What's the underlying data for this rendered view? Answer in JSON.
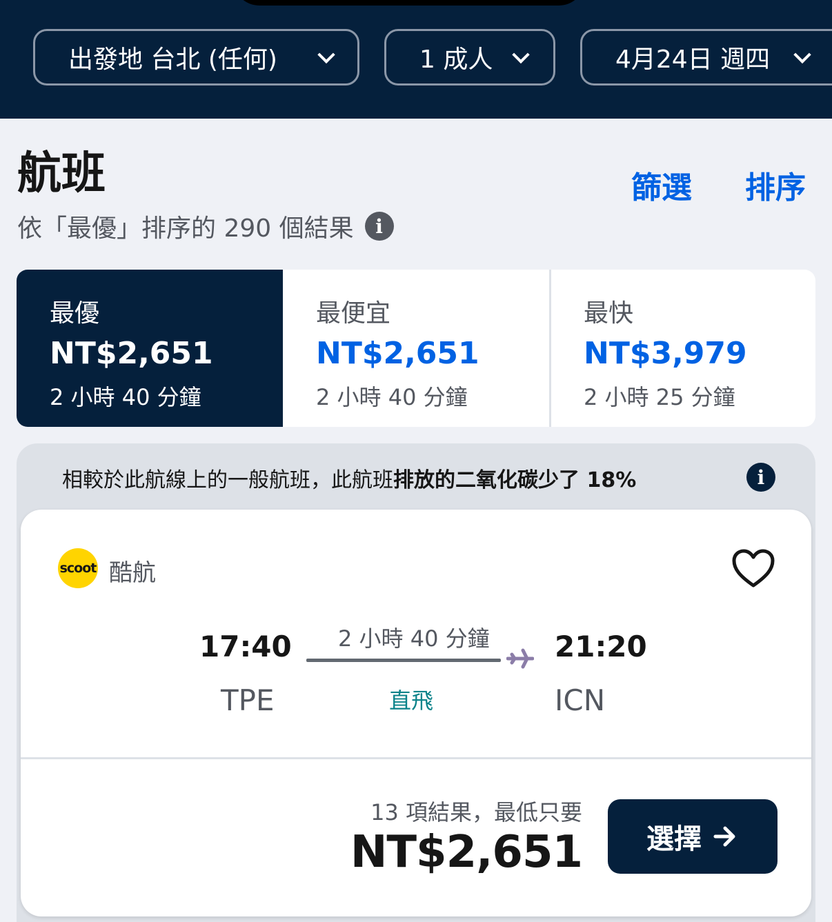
{
  "search": {
    "origin": "出發地 台北 (任何)",
    "passengers": "1 成人",
    "date": "4月24日 週四"
  },
  "results_header": {
    "title": "航班",
    "filter_label": "篩選",
    "sort_label": "排序",
    "subtitle": "依「最優」排序的 290 個結果"
  },
  "sort_tabs": [
    {
      "label": "最優",
      "price": "NT$2,651",
      "duration": "2 小時 40 分鐘",
      "selected": true
    },
    {
      "label": "最便宜",
      "price": "NT$2,651",
      "duration": "2 小時 40 分鐘",
      "selected": false
    },
    {
      "label": "最快",
      "price": "NT$3,979",
      "duration": "2 小時 25 分鐘",
      "selected": false
    }
  ],
  "eco_banner": {
    "text_prefix": "相較於此航線上的一般航班，此航班",
    "text_bold": "排放的二氧化碳少了 18%"
  },
  "flight_card": {
    "airline_logo_text": "scoot",
    "airline_name": "酷航",
    "departure_time": "17:40",
    "departure_code": "TPE",
    "arrival_time": "21:20",
    "arrival_code": "ICN",
    "duration": "2 小時 40 分鐘",
    "stops": "直飛",
    "results_note": "13 項結果，最低只要",
    "price": "NT$2,651",
    "select_label": "選擇"
  },
  "icons": {
    "dropdown": "chevron-down-icon",
    "info": "info-icon",
    "favorite": "heart-icon",
    "plane": "plane-icon",
    "arrow": "arrow-right-icon"
  },
  "colors": {
    "header_bg": "#05203c",
    "accent_blue": "#0062e3",
    "direct_teal": "#0c838a",
    "airline_yellow": "#ffd400"
  }
}
